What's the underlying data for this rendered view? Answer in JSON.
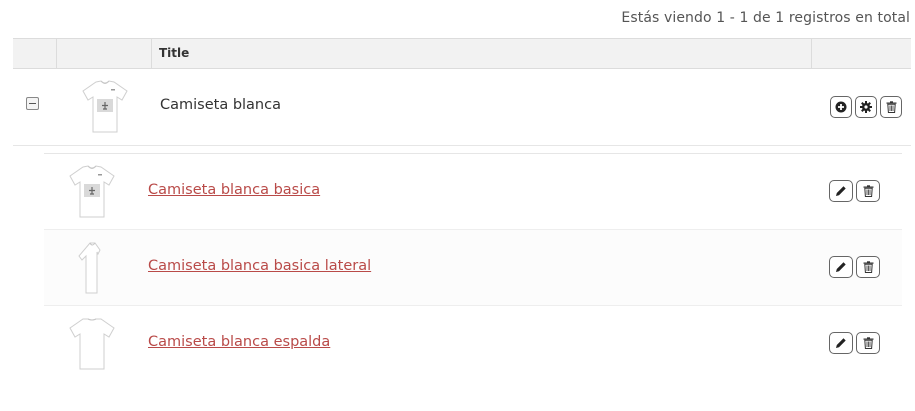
{
  "summary_text": "Estás viendo 1 - 1 de 1 registros en total",
  "table": {
    "headers": {
      "toggle": "",
      "thumbnail": "",
      "title": "Title",
      "actions": ""
    },
    "parent": {
      "title": "Camiseta blanca",
      "thumbnail_icon": "tshirt-front-with-logo-icon",
      "actions": [
        "add-circle-icon",
        "gear-icon",
        "trash-icon"
      ]
    },
    "children": [
      {
        "title": "Camiseta blanca basica",
        "thumbnail_icon": "tshirt-front-with-logo-icon",
        "actions": [
          "pencil-icon",
          "trash-icon"
        ]
      },
      {
        "title": "Camiseta blanca basica lateral",
        "thumbnail_icon": "tshirt-side-icon",
        "actions": [
          "pencil-icon",
          "trash-icon"
        ]
      },
      {
        "title": "Camiseta blanca espalda",
        "thumbnail_icon": "tshirt-back-icon",
        "actions": [
          "pencil-icon",
          "trash-icon"
        ]
      }
    ]
  },
  "colors": {
    "link": "#b94a48",
    "header_bg": "#f2f2f2",
    "border": "#dcdcdc"
  }
}
